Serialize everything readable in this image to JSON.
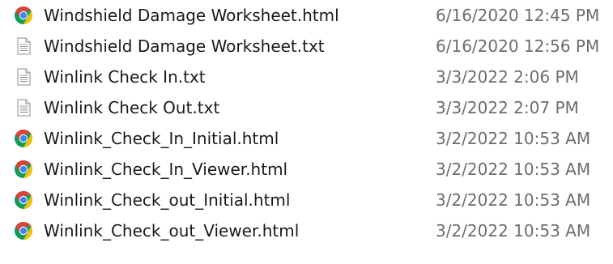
{
  "files": [
    {
      "name": "Windshield Damage Worksheet.html",
      "modified": "6/16/2020 12:45 PM",
      "icon": "chrome-html-file-icon"
    },
    {
      "name": "Windshield Damage Worksheet.txt",
      "modified": "6/16/2020 12:56 PM",
      "icon": "text-file-icon"
    },
    {
      "name": "Winlink Check In.txt",
      "modified": "3/3/2022 2:06 PM",
      "icon": "text-file-icon"
    },
    {
      "name": "Winlink Check Out.txt",
      "modified": "3/3/2022 2:07 PM",
      "icon": "text-file-icon"
    },
    {
      "name": "Winlink_Check_In_Initial.html",
      "modified": "3/2/2022 10:53 AM",
      "icon": "chrome-html-file-icon"
    },
    {
      "name": "Winlink_Check_In_Viewer.html",
      "modified": "3/2/2022 10:53 AM",
      "icon": "chrome-html-file-icon"
    },
    {
      "name": "Winlink_Check_out_Initial.html",
      "modified": "3/2/2022 10:53 AM",
      "icon": "chrome-html-file-icon"
    },
    {
      "name": "Winlink_Check_out_Viewer.html",
      "modified": "3/2/2022 10:53 AM",
      "icon": "chrome-html-file-icon"
    }
  ],
  "colors": {
    "chrome_red": "#db4437",
    "chrome_yellow": "#f4c20d",
    "chrome_green": "#0f9d58",
    "chrome_blue": "#4285f4",
    "name_text": "#1a1a1a",
    "date_text": "#6d6d6d"
  }
}
